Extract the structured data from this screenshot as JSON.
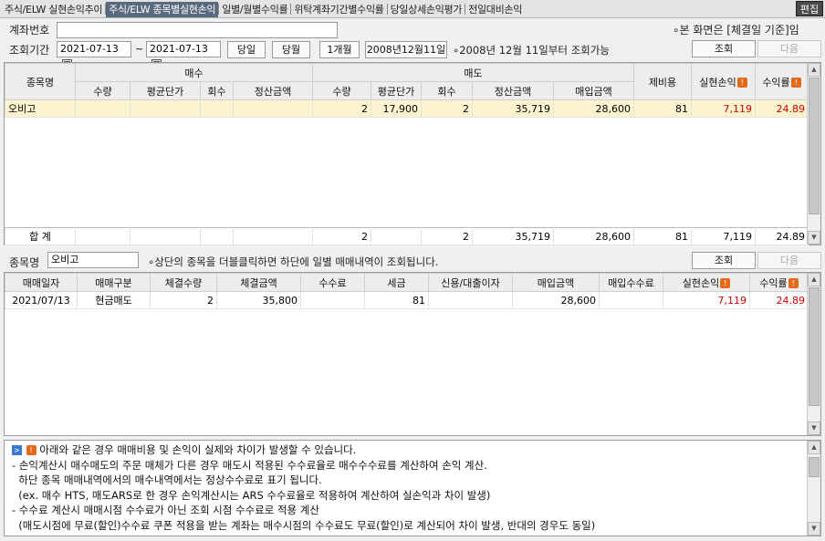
{
  "tabs": [
    "주식/ELW 실현손익추이",
    "주식/ELW 종목별실현손익",
    "일별/월별수익률",
    "위탁계좌기간별수익률",
    "당일상세손익평가",
    "전일대비손익"
  ],
  "active_tab": 1,
  "edit_label": "편집",
  "account_label": "계좌번호",
  "account_value": "",
  "screen_notice": "∘본 화면은 [체결일 기준]임",
  "period_label": "조회기간",
  "date_from": "2021-07-13",
  "date_to": "2021-07-13",
  "tilde": "~",
  "btn_today": "당일",
  "btn_month": "당월",
  "btn_1month": "1개월",
  "date_display": "2008년12월11일",
  "date_note": "∘2008년 12월 11일부터 조회가능",
  "btn_query": "조회",
  "btn_next": "다음",
  "upper": {
    "h_name": "종목명",
    "h_buy": "매수",
    "h_sell": "매도",
    "h_fee": "제비용",
    "h_pnl": "실현손익",
    "h_rate": "수익률",
    "buy_cols": [
      "수량",
      "평균단가",
      "회수",
      "정산금액"
    ],
    "sell_cols": [
      "수량",
      "평균단가",
      "회수",
      "정산금액",
      "매입금액"
    ],
    "row": {
      "name": "오비고",
      "buy_qty": "",
      "buy_avg": "",
      "buy_cnt": "",
      "buy_amt": "",
      "sell_qty": "2",
      "sell_avg": "17,900",
      "sell_cnt": "2",
      "sell_amt": "35,719",
      "buy_cost": "28,600",
      "fee": "81",
      "pnl": "7,119",
      "rate": "24.89"
    },
    "total": {
      "label": "합 계",
      "sell_qty": "2",
      "sell_cnt": "2",
      "sell_amt": "35,719",
      "buy_cost": "28,600",
      "fee": "81",
      "pnl": "7,119",
      "rate": "24.89"
    }
  },
  "mid": {
    "label": "종목명",
    "value": "오비고",
    "note": "∘상단의 종목을 더블클릭하면 하단에 일별 매매내역이 조회됩니다."
  },
  "lower": {
    "cols": [
      "매매일자",
      "매매구분",
      "체결수량",
      "체결금액",
      "수수료",
      "세금",
      "신용/대출이자",
      "매입금액",
      "매입수수료",
      "실현손익",
      "수익률"
    ],
    "row": {
      "date": "2021/07/13",
      "type": "현금매도",
      "qty": "2",
      "amount": "35,800",
      "commission": "",
      "tax": "81",
      "interest": "",
      "buy_amt": "28,600",
      "buy_fee": "",
      "pnl": "7,119",
      "rate": "24.89"
    }
  },
  "badge_text": "!",
  "info_badge": ">",
  "notice_lines": [
    "아래와 같은 경우 매매비용 및 손익이 실제와 차이가 발생할 수 있습니다.",
    "- 손익계산시 매수매도의 주문 매체가 다른 경우 매도시 적용된 수수료율로 매수수수료를 계산하여 손익 계산.",
    "  하단 종목 매매내역에서의 매수내역에서는 정상수수료로 표기 됩니다.",
    "  (ex. 매수 HTS, 매도ARS로 한 경우 손익계산시는 ARS 수수료율로 적용하여 계산하여 실손익과 차이 발생)",
    "- 수수료 계산시 매매시점 수수료가 아닌 조회 시점 수수료로 적용 계산",
    "  (매도시점에 무료(할인)수수료 쿠폰 적용을 받는 계좌는 매수시점의 수수료도 무료(할인)로 계산되어 차이 발생, 반대의 경우도 동일)"
  ]
}
